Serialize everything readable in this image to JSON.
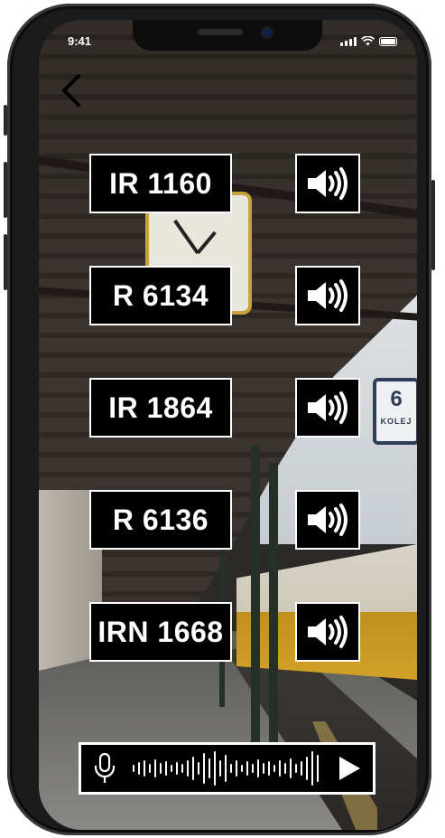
{
  "status_bar": {
    "time": "9:41"
  },
  "scene": {
    "platform_sign_number": "6",
    "platform_sign_text": "KOLEJ"
  },
  "trains": [
    {
      "label": "IR 1160"
    },
    {
      "label": "R 6134"
    },
    {
      "label": "IR 1864"
    },
    {
      "label": "R 6136"
    },
    {
      "label": "IRN 1668"
    }
  ],
  "icons": {
    "back": "chevron-left-icon",
    "sound": "speaker-volume-icon",
    "mic": "microphone-icon",
    "wave": "audio-waveform-icon",
    "play": "play-icon"
  },
  "colors": {
    "button_bg": "#000000",
    "button_border": "#ffffff",
    "text": "#ffffff"
  }
}
